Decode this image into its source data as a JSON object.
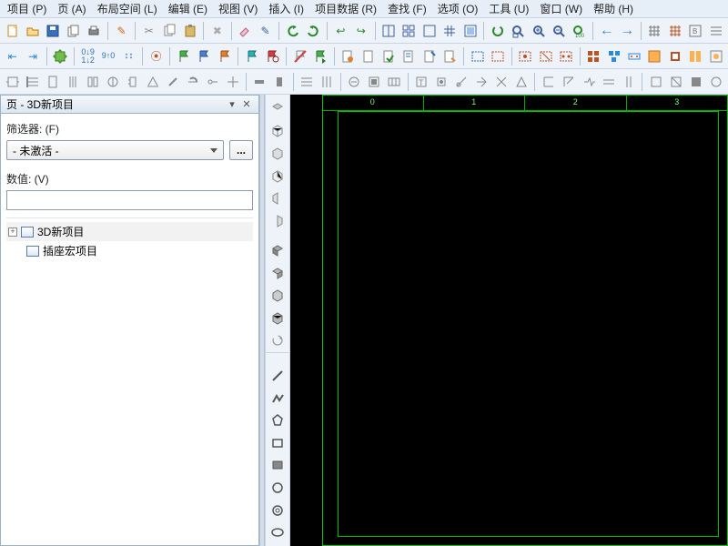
{
  "menu": {
    "project": "项目 (P)",
    "page": "页 (A)",
    "layout": "布局空间 (L)",
    "edit": "编辑 (E)",
    "view": "视图 (V)",
    "insert": "插入 (I)",
    "projectdata": "项目数据 (R)",
    "find": "查找 (F)",
    "options": "选项 (O)",
    "tools": "工具 (U)",
    "window": "窗口 (W)",
    "help": "帮助 (H)"
  },
  "panel": {
    "title": "页 - 3D新项目",
    "filter_label": "筛选器: (F)",
    "filter_value": "- 未激活 -",
    "ellipsis": "...",
    "value_label": "数值: (V)",
    "value_text": ""
  },
  "tree": {
    "items": [
      {
        "label": "3D新项目",
        "expandable": true,
        "expanded": false,
        "selected": true
      },
      {
        "label": "插座宏项目",
        "expandable": false,
        "indent": 1
      }
    ]
  },
  "ruler": {
    "cols": [
      "0",
      "1",
      "2",
      "3"
    ]
  }
}
